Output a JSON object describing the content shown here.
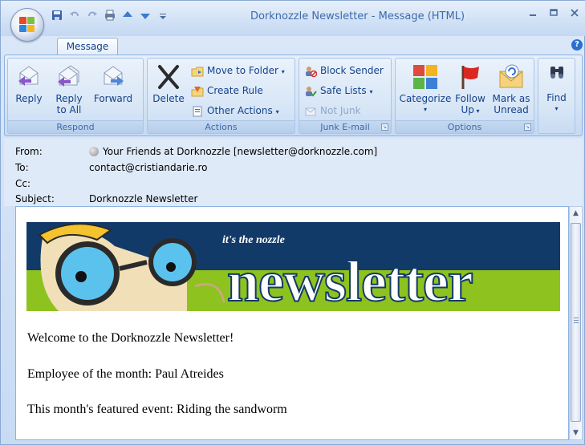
{
  "window": {
    "title": "Dorknozzle Newsletter - Message (HTML)"
  },
  "tabs": [
    {
      "label": "Message"
    }
  ],
  "ribbon": {
    "groups": {
      "respond": {
        "label": "Respond",
        "buttons": [
          {
            "label": "Reply",
            "icon": "reply-icon"
          },
          {
            "label": "Reply\nto All",
            "line1": "Reply",
            "line2": "to All",
            "icon": "reply-all-icon"
          },
          {
            "label": "Forward",
            "icon": "forward-icon"
          }
        ]
      },
      "actions": {
        "label": "Actions",
        "delete": {
          "label": "Delete",
          "icon": "delete-icon"
        },
        "move_to_folder": "Move to Folder",
        "create_rule": "Create Rule",
        "other_actions": "Other Actions"
      },
      "junk": {
        "label": "Junk E-mail",
        "block_sender": "Block Sender",
        "safe_lists": "Safe Lists",
        "not_junk": "Not Junk"
      },
      "options": {
        "label": "Options",
        "categorize": "Categorize",
        "follow_up_line1": "Follow",
        "follow_up_line2": "Up",
        "mark_line1": "Mark as",
        "mark_line2": "Unread"
      },
      "find": {
        "label": "Find"
      }
    }
  },
  "header": {
    "from_label": "From:",
    "from_value": "Your Friends at Dorknozzle [newsletter@dorknozzle.com]",
    "to_label": "To:",
    "to_value": "contact@cristiandarie.ro",
    "cc_label": "Cc:",
    "cc_value": "",
    "subject_label": "Subject:",
    "subject_value": "Dorknozzle Newsletter"
  },
  "banner": {
    "tagline": "it's the nozzle",
    "word": "newsletter",
    "colors": {
      "navy": "#123a69",
      "green": "#8dc21f"
    }
  },
  "message": {
    "lines": [
      "Welcome to the Dorknozzle Newsletter!",
      "Employee of the month: Paul Atreides",
      "This month's featured event: Riding the sandworm"
    ]
  }
}
